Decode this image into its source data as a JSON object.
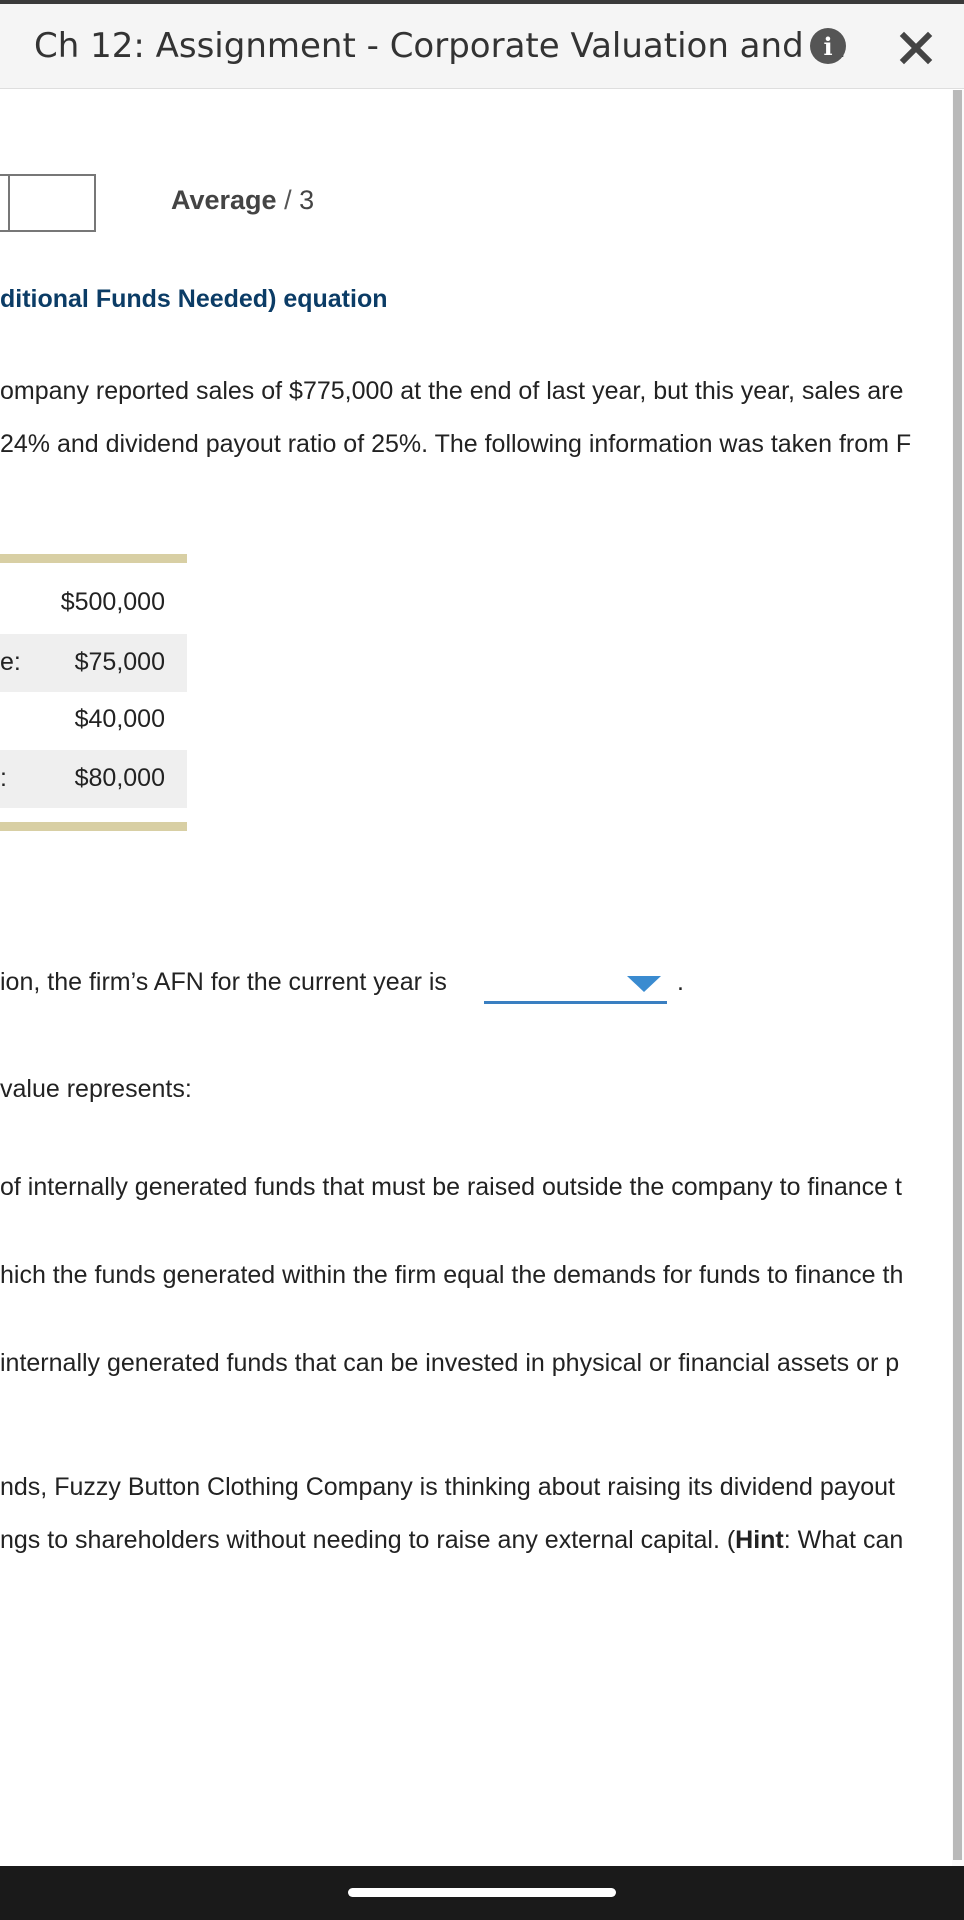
{
  "header": {
    "title": "Ch 12: Assignment - Corporate Valuation and ...",
    "info_icon": "info-icon",
    "close_icon": "close-icon"
  },
  "score": {
    "label": "Average",
    "separator": "/",
    "max": "3"
  },
  "section": {
    "heading": "ditional Funds Needed) equation"
  },
  "problem": {
    "line1": "ompany reported sales of $775,000 at the end of last year, but this year, sales are",
    "line2": "24% and dividend payout ratio of 25%. The following information was taken from F"
  },
  "table": {
    "rows": [
      {
        "label": "",
        "value": "$500,000"
      },
      {
        "label": "e:",
        "value": "$75,000"
      },
      {
        "label": "",
        "value": "$40,000"
      },
      {
        "label": ":",
        "value": "$80,000"
      }
    ]
  },
  "question1": {
    "text": "ion, the firm’s AFN for the current year is",
    "dropdown_value": "",
    "trailing": "."
  },
  "question2": {
    "text": "value represents:"
  },
  "options": [
    "of internally generated funds that must be raised outside the company to finance t",
    "hich the funds generated within the firm equal the demands for funds to finance th",
    " internally generated funds that can be invested in physical or financial assets or p"
  ],
  "question3": {
    "line1": "nds, Fuzzy Button Clothing Company is thinking about raising its dividend payout",
    "line2_prefix": "ngs to shareholders without needing to raise any external capital. (",
    "line2_hint": "Hint",
    "line2_suffix": ": What can"
  },
  "colors": {
    "heading": "#0b3c66",
    "table_border": "#d8cfa4",
    "dropdown_accent": "#3a8bd0"
  }
}
